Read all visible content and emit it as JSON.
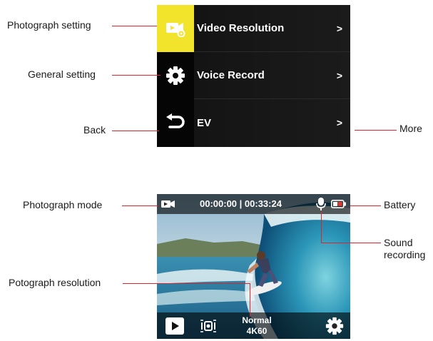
{
  "menu": {
    "items": [
      {
        "label": "Video Resolution",
        "icon": "video-settings-icon",
        "active": true
      },
      {
        "label": "Voice Record",
        "icon": "gear-icon",
        "active": false
      },
      {
        "label": "EV",
        "icon": "back-arrow-icon",
        "active": false
      }
    ],
    "chevron": ">",
    "accent": "#f2e32b"
  },
  "liveview": {
    "timer": "00:00:00 | 00:33:24",
    "quality": "Normal",
    "resolution": "4K60",
    "mode_icon": "video-camera-icon",
    "mic_icon": "microphone-icon",
    "battery_icon": "battery-icon",
    "play_icon": "play-icon",
    "stabilization_icon": "stabilization-icon",
    "settings_icon": "gear-icon"
  },
  "callouts": {
    "photograph_setting": "Photograph setting",
    "general_setting": "General setting",
    "back": "Back",
    "more": "More",
    "photograph_mode": "Photograph mode",
    "battery": "Battery",
    "sound_recording": "Sound",
    "sound_recording_2": "recording",
    "resolution": "Potograph resolution"
  },
  "colors": {
    "leader_line": "#d8262f",
    "menu_bg": "#111111"
  }
}
